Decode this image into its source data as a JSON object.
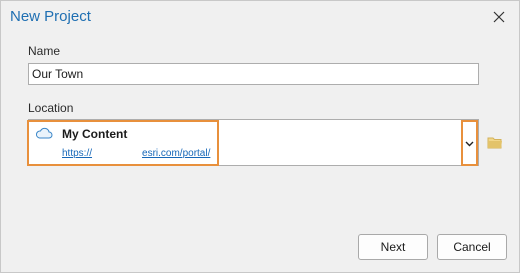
{
  "dialog": {
    "title": "New Project",
    "close_icon": "close-icon"
  },
  "name_field": {
    "label": "Name",
    "value": "Our Town"
  },
  "location_field": {
    "label": "Location",
    "selected": {
      "icon": "cloud-icon",
      "title": "My Content",
      "url_part1": "https://",
      "url_part2": "esri.com/portal/"
    },
    "dropdown_icon": "chevron-down-icon",
    "browse_icon": "folder-icon"
  },
  "buttons": {
    "next": "Next",
    "cancel": "Cancel"
  },
  "colors": {
    "title": "#1f6fb2",
    "highlight": "#e8903c",
    "link": "#1667b8",
    "folder": "#e3c36a"
  }
}
